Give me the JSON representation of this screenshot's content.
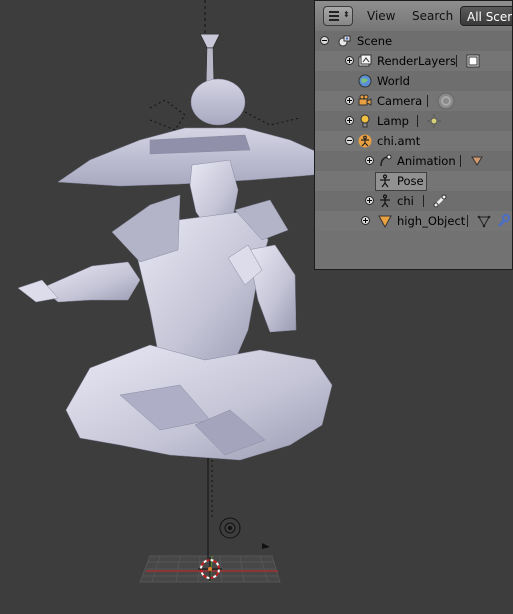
{
  "outliner": {
    "header": {
      "view": "View",
      "search": "Search",
      "scene_select": "All Scenes",
      "editor_icon": "outliner-editor-icon"
    },
    "tree": {
      "scene": "Scene",
      "render_layers": "RenderLayers",
      "world": "World",
      "camera": "Camera",
      "lamp": "Lamp",
      "armature_object": "chi.amt",
      "animation": "Animation",
      "pose": "Pose",
      "armature_data": "chi",
      "mesh_object": "high_Object"
    }
  },
  "viewport": {
    "objects": [
      "seated-figure-mesh",
      "armature-bones",
      "camera",
      "lamp",
      "3d-cursor"
    ]
  }
}
